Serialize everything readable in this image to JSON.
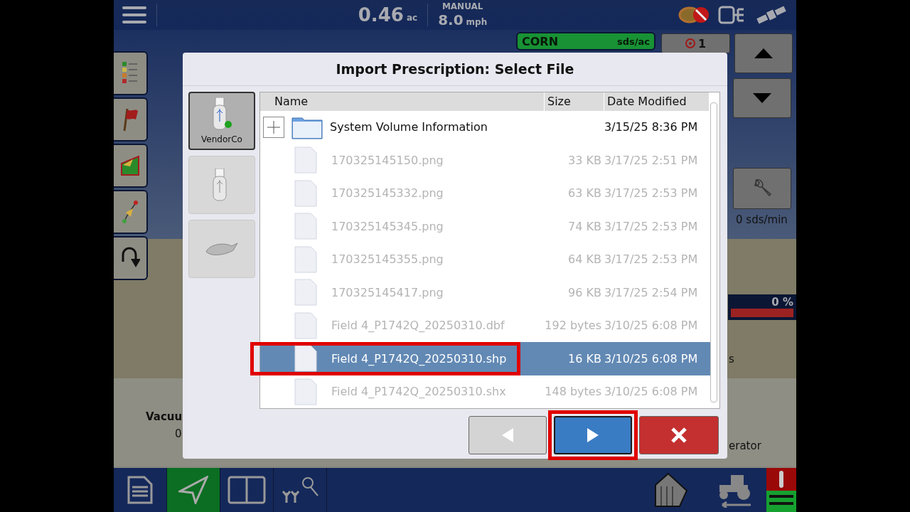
{
  "top_bar": {
    "area": "0.46",
    "area_unit": "ac",
    "mode": "MANUAL",
    "speed": "8.0",
    "speed_unit": "mph"
  },
  "product": {
    "name": "CORN",
    "unit": "sds/ac"
  },
  "target": {
    "count": "1"
  },
  "rate_reading": "0 sds/min",
  "progress": {
    "reading": "0 %",
    "level": 1
  },
  "background_texts": {
    "left_title": "Vacuu",
    "left_value": "0",
    "right_fragment": "s",
    "right_label": "erator"
  },
  "dialog": {
    "title": "Import Prescription: Select File",
    "sources": [
      {
        "kind": "usb",
        "label": "VendorCo",
        "selected": true,
        "connected": true
      },
      {
        "kind": "usb",
        "selected": false,
        "connected": false
      },
      {
        "kind": "cloud",
        "selected": false
      }
    ],
    "columns": [
      "Name",
      "Size",
      "Date Modified"
    ],
    "rows": [
      {
        "kind": "folder",
        "name": "System Volume Information",
        "size": "",
        "date": "3/15/25 8:36 PM",
        "disabled": false,
        "selected": false,
        "expanded": false,
        "highlighted": false
      },
      {
        "kind": "file",
        "name": "170325145150.png",
        "size": "33 KB",
        "date": "3/17/25 2:51 PM",
        "disabled": true,
        "selected": false,
        "highlighted": false
      },
      {
        "kind": "file",
        "name": "170325145332.png",
        "size": "63 KB",
        "date": "3/17/25 2:53 PM",
        "disabled": true,
        "selected": false,
        "highlighted": false
      },
      {
        "kind": "file",
        "name": "170325145345.png",
        "size": "74 KB",
        "date": "3/17/25 2:53 PM",
        "disabled": true,
        "selected": false,
        "highlighted": false
      },
      {
        "kind": "file",
        "name": "170325145355.png",
        "size": "64 KB",
        "date": "3/17/25 2:53 PM",
        "disabled": true,
        "selected": false,
        "highlighted": false
      },
      {
        "kind": "file",
        "name": "170325145417.png",
        "size": "96 KB",
        "date": "3/17/25 2:54 PM",
        "disabled": true,
        "selected": false,
        "highlighted": false
      },
      {
        "kind": "file",
        "name": "Field 4_P1742Q_20250310.dbf",
        "size": "192 bytes",
        "date": "3/10/25 6:08 PM",
        "disabled": true,
        "selected": false,
        "highlighted": false
      },
      {
        "kind": "file",
        "name": "Field 4_P1742Q_20250310.shp",
        "size": "16 KB",
        "date": "3/10/25 6:08 PM",
        "disabled": false,
        "selected": true,
        "highlighted": true
      },
      {
        "kind": "file",
        "name": "Field 4_P1742Q_20250310.shx",
        "size": "148 bytes",
        "date": "3/10/25 6:08 PM",
        "disabled": true,
        "selected": false,
        "highlighted": false
      }
    ],
    "buttons": [
      {
        "kind": "back",
        "disabled": true,
        "highlighted": false
      },
      {
        "kind": "next",
        "disabled": false,
        "highlighted": true
      },
      {
        "kind": "cancel",
        "disabled": false,
        "highlighted": false
      }
    ]
  },
  "bottom_tabs": [
    {
      "kind": "list",
      "selected": false
    },
    {
      "kind": "guidance",
      "selected": true
    },
    {
      "kind": "split",
      "selected": false
    },
    {
      "kind": "plants",
      "selected": false
    }
  ]
}
